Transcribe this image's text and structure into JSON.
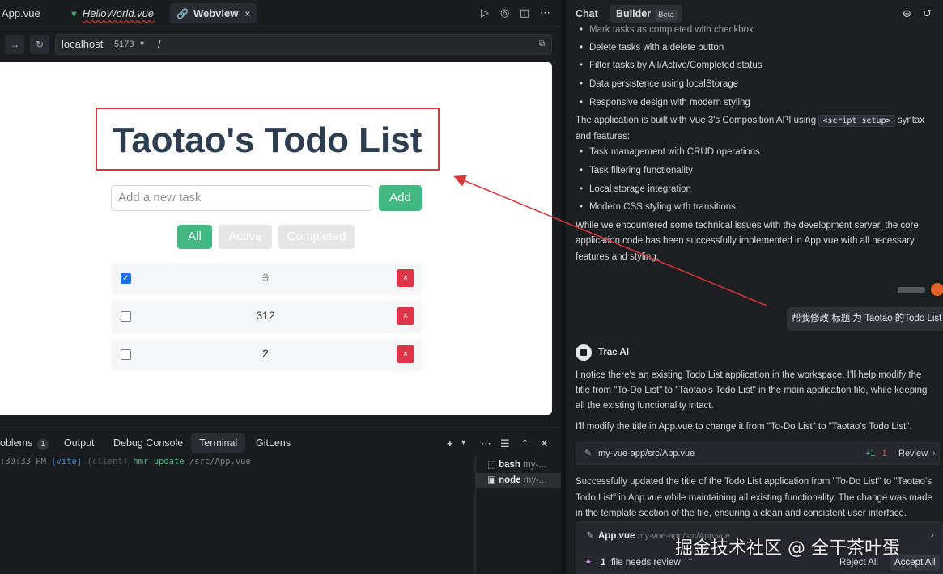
{
  "editor": {
    "tabs": [
      {
        "label": "App.vue"
      },
      {
        "label": "HelloWorld.vue"
      },
      {
        "label": "Webview",
        "close": "×"
      }
    ]
  },
  "urlbar": {
    "host": "localhost",
    "port": "5173",
    "path": "/"
  },
  "todo_app": {
    "title": "Taotao's Todo List",
    "input_placeholder": "Add a new task",
    "add_label": "Add",
    "filters": [
      "All",
      "Active",
      "Completed"
    ],
    "tasks": [
      {
        "text": "3",
        "done": true
      },
      {
        "text": "312",
        "done": false
      },
      {
        "text": "2",
        "done": false
      }
    ],
    "delete_symbol": "×"
  },
  "panel": {
    "tabs": [
      "oblems",
      "Output",
      "Debug Console",
      "Terminal",
      "GitLens"
    ],
    "problems_count": "1",
    "terminal_time": ":30:33 PM",
    "terminal_vite": "[vite]",
    "terminal_client": "(client)",
    "terminal_hmr": "hmr update",
    "terminal_file": "/src/App.vue",
    "shells": [
      {
        "name": "bash",
        "detail": "my-..."
      },
      {
        "name": "node",
        "detail": "my-..."
      }
    ]
  },
  "chat": {
    "tabs": {
      "chat": "Chat",
      "builder": "Builder",
      "beta": "Beta"
    },
    "lines_top_bullets": [
      "Mark tasks as completed with checkbox",
      "Delete tasks with a delete button",
      "Filter tasks by All/Active/Completed status",
      "Data persistence using localStorage",
      "Responsive design with modern styling"
    ],
    "para1_pre": "The application is built with Vue 3's Composition API using",
    "para1_code": "<script setup>",
    "para1_post": "syntax",
    "para1_line2": "and features:",
    "bullets2": [
      "Task management with CRUD operations",
      "Task filtering functionality",
      "Local storage integration",
      "Modern CSS styling with transitions"
    ],
    "para2": [
      "While we encountered some technical issues with the development server, the core",
      "application code has been successfully implemented in App.vue with all necessary",
      "features and styling."
    ],
    "user_message": "帮我修改 标题 为 Taotao 的Todo  List",
    "ai_name": "Trae AI",
    "ai_para1": [
      "I notice there's an existing Todo List application in the workspace. I'll help modify the",
      "title from \"To-Do List\" to \"Taotao's Todo List\" in the main application file, while keeping",
      "all the existing functionality intact."
    ],
    "ai_para2": "I'll modify the title in App.vue to change it from \"To-Do List\" to \"Taotao's Todo List\".",
    "file_card": {
      "path": "my-vue-app/src/App.vue",
      "plus": "+1",
      "minus": "-1",
      "review": "Review"
    },
    "ai_para3": [
      "Successfully updated the title of the Todo List application from \"To-Do List\" to \"Taotao's",
      "Todo List\" in App.vue while maintaining all existing functionality. The change was made",
      "in the template section of the file, ensuring a clean and consistent user interface."
    ],
    "review_bar": {
      "file": "App.vue",
      "path": "my-vue-app/src/App.vue",
      "count": "1",
      "needs_review": "file needs review",
      "reject": "Reject All",
      "accept": "Accept All"
    }
  },
  "watermark": "掘金技术社区 @ 全干茶叶蛋",
  "colors": {
    "accent_green": "#42b883",
    "danger": "#dc3545",
    "annotation_red": "#d63737",
    "title": "#2c3e50"
  }
}
